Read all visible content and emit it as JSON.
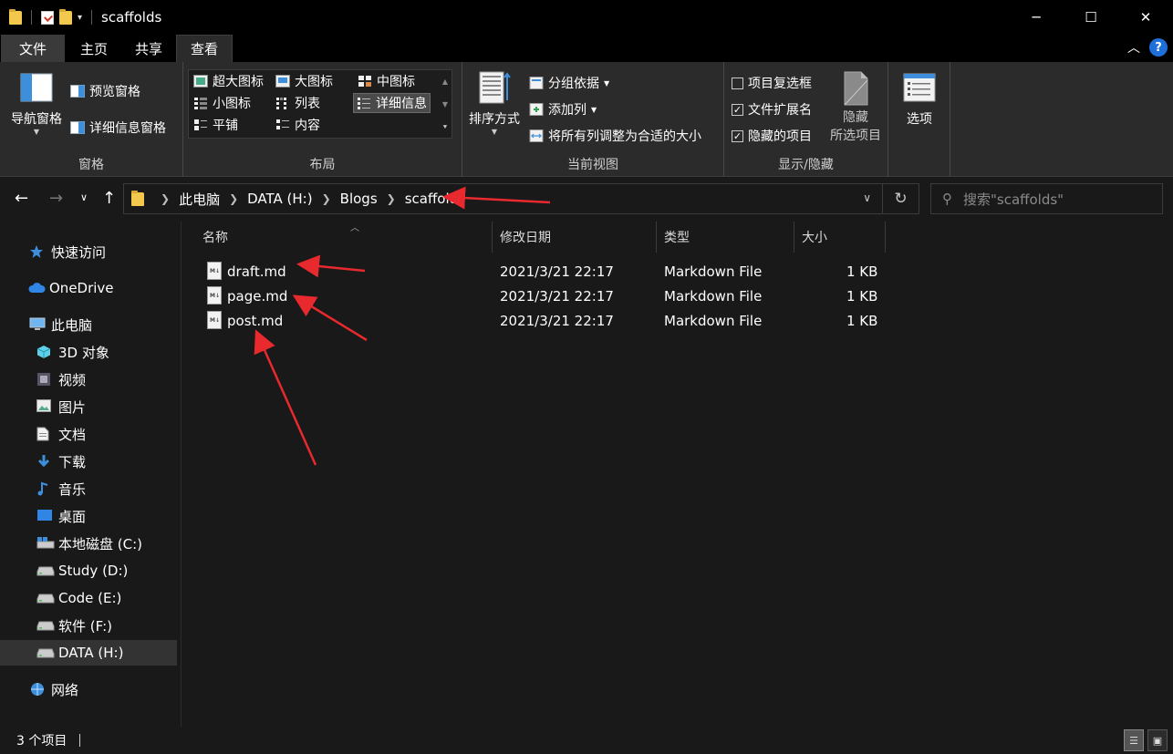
{
  "window": {
    "title": "scaffolds",
    "minimize_glyph": "─",
    "maximize_glyph": "☐",
    "close_glyph": "✕"
  },
  "ribbon_tabs": {
    "file": "文件",
    "home": "主页",
    "share": "共享",
    "view": "查看"
  },
  "ribbon": {
    "panes": {
      "nav_pane": "导航窗格",
      "preview_pane": "预览窗格",
      "details_pane": "详细信息窗格",
      "group_label": "窗格"
    },
    "layout": {
      "extra_large": "超大图标",
      "large": "大图标",
      "medium": "中图标",
      "small": "小图标",
      "list": "列表",
      "details": "详细信息",
      "tiles": "平铺",
      "content": "内容",
      "group_label": "布局"
    },
    "current_view": {
      "sort_by": "排序方式",
      "group_by": "分组依据",
      "add_columns": "添加列",
      "size_all_columns": "将所有列调整为合适的大小",
      "group_label": "当前视图"
    },
    "show_hide": {
      "item_checkboxes": "项目复选框",
      "item_checkboxes_checked": "",
      "file_extensions": "文件扩展名",
      "file_extensions_checked": "✓",
      "hidden_items": "隐藏的项目",
      "hidden_items_checked": "✓",
      "hide_selected_1": "隐藏",
      "hide_selected_2": "所选项目",
      "group_label": "显示/隐藏"
    },
    "options": "选项"
  },
  "address": {
    "breadcrumbs": [
      "此电脑",
      "DATA (H:)",
      "Blogs",
      "scaffolds"
    ],
    "search_placeholder": "搜索\"scaffolds\""
  },
  "sidebar": {
    "items": [
      {
        "label": "快速访问",
        "icon": "star-icon"
      },
      {
        "label": "OneDrive",
        "icon": "cloud-icon"
      },
      {
        "label": "此电脑",
        "icon": "computer-icon"
      },
      {
        "label": "3D 对象",
        "icon": "cube-icon"
      },
      {
        "label": "视频",
        "icon": "video-icon"
      },
      {
        "label": "图片",
        "icon": "picture-icon"
      },
      {
        "label": "文档",
        "icon": "document-icon"
      },
      {
        "label": "下载",
        "icon": "download-icon"
      },
      {
        "label": "音乐",
        "icon": "music-icon"
      },
      {
        "label": "桌面",
        "icon": "desktop-icon"
      },
      {
        "label": "本地磁盘 (C:)",
        "icon": "system-drive-icon"
      },
      {
        "label": "Study (D:)",
        "icon": "drive-icon"
      },
      {
        "label": "Code (E:)",
        "icon": "drive-icon"
      },
      {
        "label": "软件 (F:)",
        "icon": "drive-icon"
      },
      {
        "label": "DATA (H:)",
        "icon": "drive-icon"
      },
      {
        "label": "网络",
        "icon": "network-icon"
      }
    ]
  },
  "file_list": {
    "columns": {
      "name": "名称",
      "modified": "修改日期",
      "type": "类型",
      "size": "大小"
    },
    "rows": [
      {
        "name": "draft.md",
        "modified": "2021/3/21 22:17",
        "type": "Markdown File",
        "size": "1 KB"
      },
      {
        "name": "page.md",
        "modified": "2021/3/21 22:17",
        "type": "Markdown File",
        "size": "1 KB"
      },
      {
        "name": "post.md",
        "modified": "2021/3/21 22:17",
        "type": "Markdown File",
        "size": "1 KB"
      }
    ]
  },
  "status": {
    "item_count": "3 个项目"
  },
  "colors": {
    "background": "#191919",
    "titlebar": "#000000",
    "ribbon": "#2b2b2b",
    "annotation_arrow": "#e8292e"
  }
}
